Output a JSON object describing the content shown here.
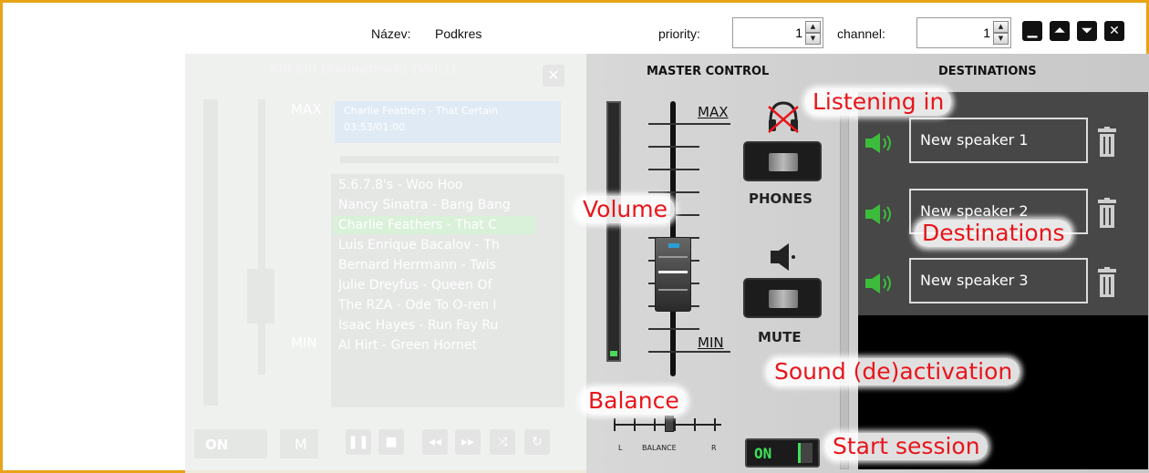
{
  "header": {
    "name_label": "Název:",
    "name_value": "Podkres",
    "priority_label": "priority:",
    "priority_value": "1",
    "channel_label": "channel:",
    "channel_value": "1",
    "window_buttons": [
      "minimize-icon",
      "move-top-icon",
      "move-bottom-icon",
      "close-icon"
    ]
  },
  "player": {
    "title": "Kill Bill (Soundtrack) (Vol.1)",
    "max_label": "MAX",
    "min_label": "MIN",
    "now_playing_line1": "Charlie Feathers - That Certain",
    "now_playing_line2": "03:53/01:00",
    "tracks": [
      "5.6.7.8's - Woo Hoo",
      "Nancy Sinatra - Bang Bang",
      "Charlie Feathers - That C",
      "Luis Enrique Bacalov - Th",
      "Bernard Herrmann - Twis",
      "Julie Dreyfus - Queen Of",
      "The RZA - Ode To O-ren I",
      "Isaac Hayes - Run Fay Ru",
      "Al Hirt - Green Hornet"
    ],
    "highlighted_track_index": 2,
    "on_label": "ON",
    "mute_label": "M",
    "controls": [
      "pause-icon",
      "stop-icon",
      "rewind-icon",
      "fast-forward-icon",
      "shuffle-icon",
      "repeat-icon"
    ]
  },
  "master": {
    "title": "MASTER CONTROL",
    "max_label": "MAX",
    "min_label": "MIN",
    "phones_label": "PHONES",
    "mute_label": "MUTE",
    "balance_label": "BALANCE",
    "balance_left": "L",
    "balance_right": "R",
    "session_label": "ON",
    "volume_level": 0.37,
    "meter_level": 0.02
  },
  "destinations": {
    "title": "DESTINATIONS",
    "items": [
      {
        "name": "New speaker 1"
      },
      {
        "name": "New speaker 2"
      },
      {
        "name": "New speaker 3"
      }
    ]
  },
  "annotations": {
    "listening": "Listening in",
    "volume": "Volume",
    "destinations": "Destinations",
    "sound": "Sound (de)activation",
    "balance": "Balance",
    "start": "Start session"
  },
  "colors": {
    "border": "#e8a317",
    "annotation": "#e8151b",
    "on_green": "#3ee05a",
    "speaker_green": "#3bbd3b"
  }
}
